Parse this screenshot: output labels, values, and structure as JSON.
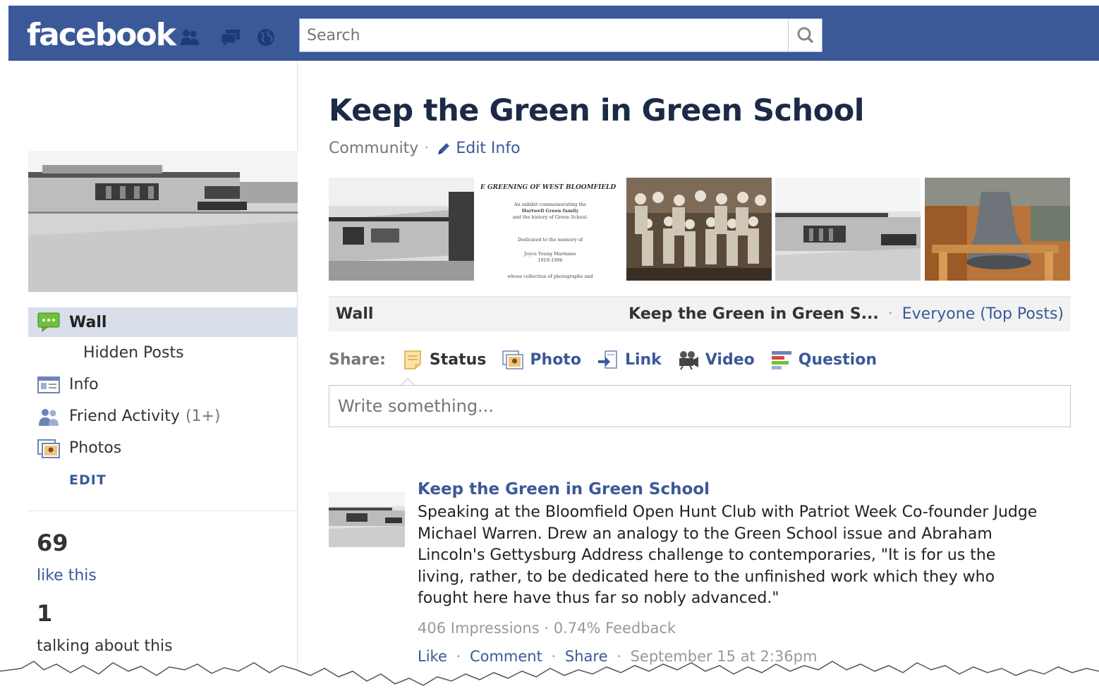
{
  "header": {
    "logo": "facebook",
    "search_placeholder": "Search",
    "icons": [
      "friend-requests-icon",
      "messages-icon",
      "notifications-icon",
      "search-icon"
    ]
  },
  "sidebar": {
    "nav": [
      {
        "label": "Wall",
        "icon": "wall-speech-bubble-icon",
        "active": true
      },
      {
        "label": "Hidden Posts",
        "icon": "",
        "sub": true
      },
      {
        "label": "Info",
        "icon": "info-card-icon"
      },
      {
        "label": "Friend Activity",
        "count": "(1+)",
        "icon": "friends-icon"
      },
      {
        "label": "Photos",
        "icon": "photos-icon"
      }
    ],
    "edit_label": "EDIT",
    "likes_count": "69",
    "likes_label": "like this",
    "talking_count": "1",
    "talking_label": "talking about this"
  },
  "page": {
    "title": "Keep the Green in Green School",
    "category": "Community",
    "edit_info": "Edit Info"
  },
  "photo_strip": {
    "card_title": "E GREENING OF WEST BLOOMFIELD",
    "card_lines": [
      "An exhibit commemorating the",
      "Hartwell Green family",
      "and the history of Green School.",
      "Dedicated to the memory of",
      "Joyce Young Marmane",
      "1919-1996",
      "whose collection of photographs and"
    ]
  },
  "wallbar": {
    "label": "Wall",
    "page_short": "Keep the Green in Green S...",
    "filter": "Everyone (Top Posts)"
  },
  "share": {
    "label": "Share:",
    "options": [
      {
        "label": "Status",
        "icon": "status-note-icon",
        "current": true
      },
      {
        "label": "Photo",
        "icon": "photo-icon"
      },
      {
        "label": "Link",
        "icon": "link-icon"
      },
      {
        "label": "Video",
        "icon": "video-camera-icon"
      },
      {
        "label": "Question",
        "icon": "question-icon"
      }
    ],
    "placeholder": "Write something..."
  },
  "post": {
    "author": "Keep the Green in Green School",
    "text": "Speaking at the Bloomfield Open Hunt Club with Patriot Week Co-founder Judge Michael Warren. Drew an analogy to the Green School issue and Abraham Lincoln's Gettysburg Address challenge to contemporaries, \"It is for us the living, rather, to be dedicated here to the unfinished work which they who fought here have thus far so nobly advanced.\"",
    "impressions": "406 Impressions",
    "feedback": "0.74% Feedback",
    "actions": [
      "Like",
      "Comment",
      "Share"
    ],
    "timestamp": "September 15 at 2:36pm"
  },
  "colors": {
    "brand_blue": "#3b5998",
    "header_border": "#133783",
    "nav_active_bg": "#d8dfea"
  }
}
